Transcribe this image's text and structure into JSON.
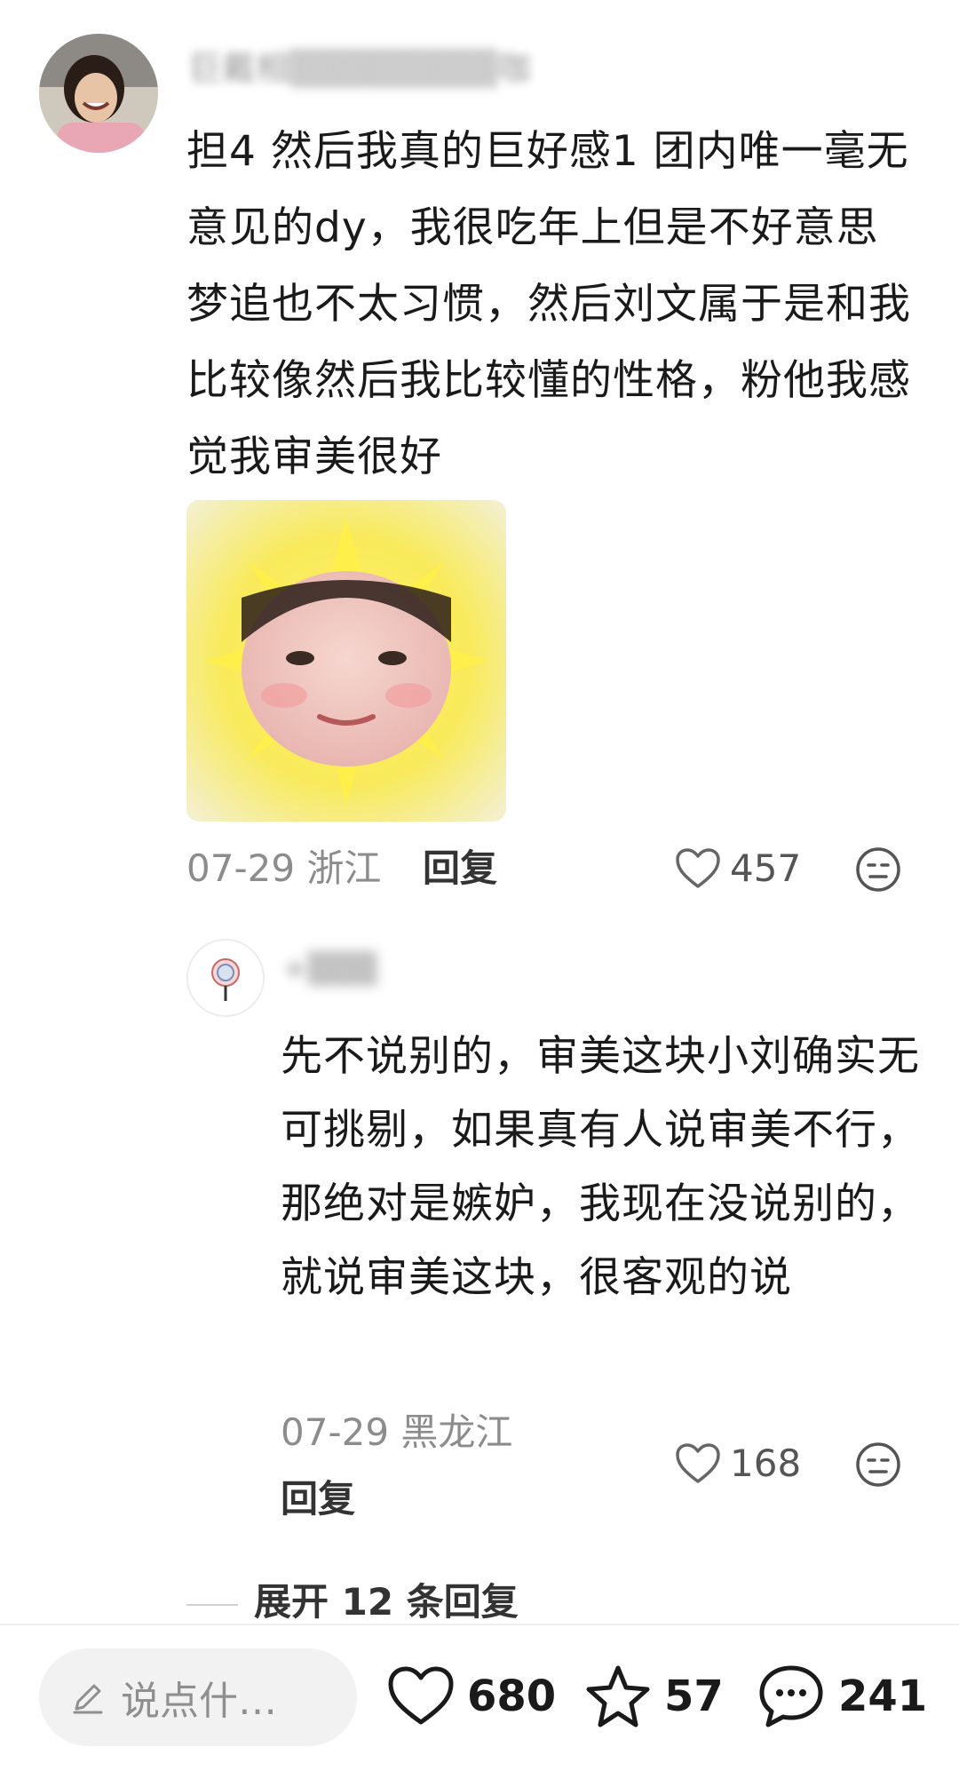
{
  "comment": {
    "username": "巨戴相▒▒▒▒▒▒▒▒咖",
    "text": "担4 然后我真的巨好感1 团内唯一毫无意见的dy，我很吃年上但是不好意思梦追也不太习惯，然后刘文属于是和我比较像然后我比较懂的性格，粉他我感觉我审美很好",
    "date_location": "07-29 浙江",
    "reply_label": "回复",
    "like_count": "457",
    "icons": {
      "like": "heart-outline-icon",
      "react": "emoji-face-icon"
    }
  },
  "reply": {
    "username": "+▒▒▒",
    "text": "先不说别的，审美这块小刘确实无可挑剔，如果真有人说审美不行，那绝对是嫉妒，我现在没说别的，就说审美这块，很客观的说",
    "date_location": "07-29 黑龙江",
    "reply_label": "回复",
    "like_count": "168"
  },
  "expand": {
    "label": "展开 12 条回复"
  },
  "bottom_bar": {
    "input_placeholder": "说点什…",
    "likes": "680",
    "favorites": "57",
    "comments": "241",
    "icons": {
      "edit": "pencil-icon",
      "like": "heart-icon",
      "favorite": "star-icon",
      "comment": "chat-bubble-icon"
    }
  },
  "colors": {
    "text": "#1a1a1a",
    "meta": "#8c8c8c",
    "sticker_yellow": "#f6e54a"
  }
}
